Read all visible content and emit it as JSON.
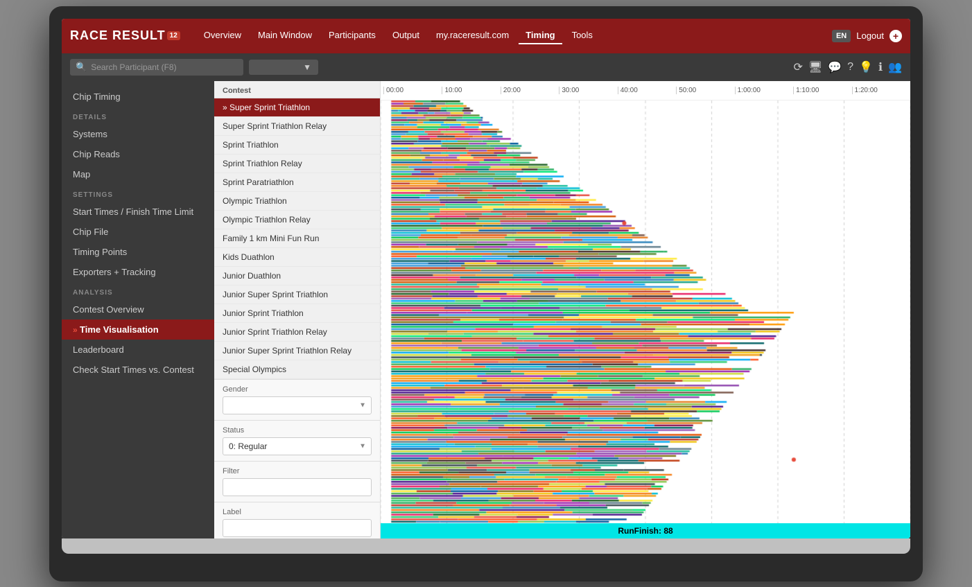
{
  "app": {
    "title": "Race Result 12",
    "logo": "RACE RESULT",
    "logo_version": "12"
  },
  "nav": {
    "links": [
      {
        "label": "Overview",
        "active": false
      },
      {
        "label": "Main Window",
        "active": false
      },
      {
        "label": "Participants",
        "active": false
      },
      {
        "label": "Output",
        "active": false
      },
      {
        "label": "my.raceresult.com",
        "active": false
      },
      {
        "label": "Timing",
        "active": true
      },
      {
        "label": "Tools",
        "active": false
      }
    ],
    "lang": "EN",
    "logout": "Logout"
  },
  "search": {
    "placeholder": "Search Participant (F8)"
  },
  "sidebar": {
    "top_item": "Chip Timing",
    "sections": [
      {
        "label": "DETAILS",
        "items": [
          {
            "label": "Systems",
            "active": false,
            "arrow": false
          },
          {
            "label": "Chip Reads",
            "active": false,
            "arrow": false
          },
          {
            "label": "Map",
            "active": false,
            "arrow": false
          }
        ]
      },
      {
        "label": "SETTINGS",
        "items": [
          {
            "label": "Start Times / Finish Time Limit",
            "active": false,
            "arrow": false
          },
          {
            "label": "Chip File",
            "active": false,
            "arrow": false
          },
          {
            "label": "Timing Points",
            "active": false,
            "arrow": false
          },
          {
            "label": "Exporters + Tracking",
            "active": false,
            "arrow": false
          }
        ]
      },
      {
        "label": "ANALYSIS",
        "items": [
          {
            "label": "Contest Overview",
            "active": false,
            "arrow": false
          },
          {
            "label": "Time Visualisation",
            "active": true,
            "arrow": true
          },
          {
            "label": "Leaderboard",
            "active": false,
            "arrow": false
          },
          {
            "label": "Check Start Times vs. Contest",
            "active": false,
            "arrow": false
          }
        ]
      }
    ]
  },
  "contest_panel": {
    "label": "Contest",
    "items": [
      {
        "label": "Super Sprint Triathlon",
        "selected": true
      },
      {
        "label": "Super Sprint Triathlon Relay",
        "selected": false
      },
      {
        "label": "Sprint Triathlon",
        "selected": false
      },
      {
        "label": "Sprint Triathlon Relay",
        "selected": false
      },
      {
        "label": "Sprint Paratriathlon",
        "selected": false
      },
      {
        "label": "Olympic Triathlon",
        "selected": false
      },
      {
        "label": "Olympic Triathlon Relay",
        "selected": false
      },
      {
        "label": "Family 1 km Mini Fun Run",
        "selected": false
      },
      {
        "label": "Kids Duathlon",
        "selected": false
      },
      {
        "label": "Junior Duathlon",
        "selected": false
      },
      {
        "label": "Junior Super Sprint Triathlon",
        "selected": false
      },
      {
        "label": "Junior Sprint Triathlon",
        "selected": false
      },
      {
        "label": "Junior Sprint Triathlon Relay",
        "selected": false
      },
      {
        "label": "Junior Super Sprint Triathlon Relay",
        "selected": false
      },
      {
        "label": "Special Olympics",
        "selected": false
      }
    ],
    "filters": {
      "gender_label": "Gender",
      "gender_value": "",
      "status_label": "Status",
      "status_value": "0: Regular",
      "filter_label": "Filter",
      "filter_value": "",
      "label_label": "Label",
      "label_value": ""
    }
  },
  "timeline": {
    "ticks": [
      "00:00",
      "10:00",
      "20:00",
      "30:00",
      "40:00",
      "50:00",
      "1:00:00",
      "1:10:00",
      "1:20:00"
    ]
  },
  "run_finish": {
    "label": "RunFinish: 88"
  }
}
